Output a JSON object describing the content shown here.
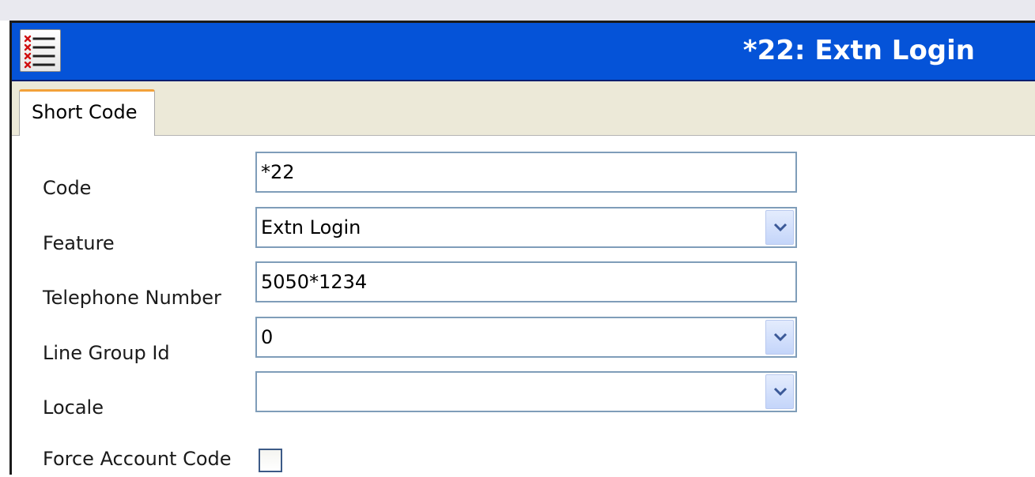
{
  "window": {
    "title": "*22: Extn Login",
    "icon": "shortcode-list-icon"
  },
  "tabs": [
    {
      "label": "Short Code",
      "active": true
    }
  ],
  "form": {
    "code": {
      "label": "Code",
      "value": "*22"
    },
    "feature": {
      "label": "Feature",
      "value": "Extn Login"
    },
    "telephone_number": {
      "label": "Telephone Number",
      "value": "5050*1234"
    },
    "line_group_id": {
      "label": "Line Group Id",
      "value": "0"
    },
    "locale": {
      "label": "Locale",
      "value": ""
    },
    "force_account_code": {
      "label": "Force Account Code",
      "checked": false
    }
  },
  "colors": {
    "titlebar": "#0553d8",
    "tab_accent": "#f2a13a",
    "field_border": "#7f9db9",
    "tabbar_bg": "#ece9d8"
  }
}
